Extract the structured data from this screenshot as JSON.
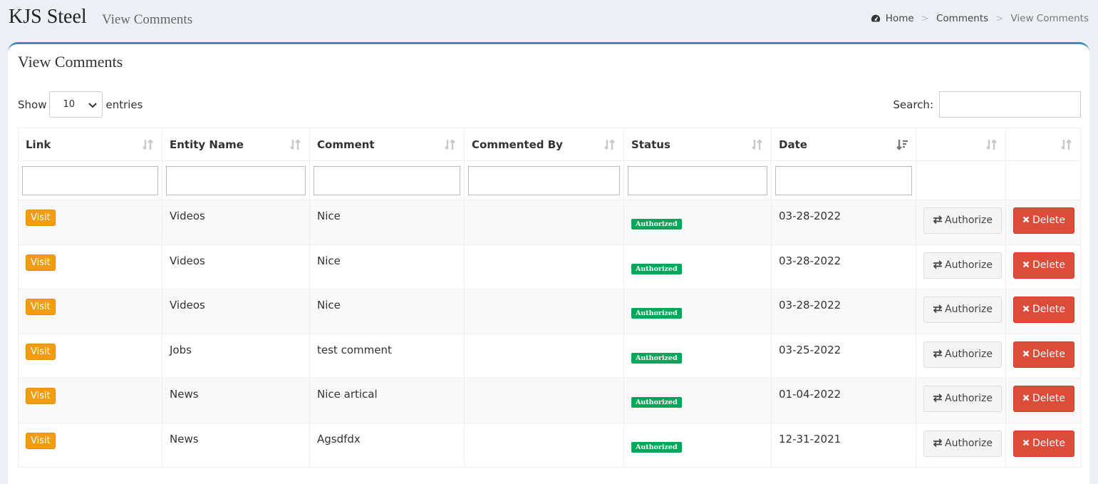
{
  "header": {
    "brand": "KJS Steel",
    "subtitle": "View Comments"
  },
  "breadcrumb": {
    "home": "Home",
    "section": "Comments",
    "current": "View Comments",
    "separator": ">"
  },
  "box": {
    "title": "View Comments"
  },
  "length": {
    "show_label": "Show",
    "value": "10",
    "entries_label": "entries"
  },
  "search": {
    "label": "Search:",
    "value": ""
  },
  "table": {
    "columns": [
      "Link",
      "Entity Name",
      "Comment",
      "Commented By",
      "Status",
      "Date",
      "",
      ""
    ],
    "rows": [
      {
        "link": "Visit",
        "entity": "Videos",
        "comment": "Nice",
        "by": "",
        "status": "Authorized",
        "date": "03-28-2022",
        "authorize": "Authorize",
        "delete": "Delete"
      },
      {
        "link": "Visit",
        "entity": "Videos",
        "comment": "Nice",
        "by": "",
        "status": "Authorized",
        "date": "03-28-2022",
        "authorize": "Authorize",
        "delete": "Delete"
      },
      {
        "link": "Visit",
        "entity": "Videos",
        "comment": "Nice",
        "by": "",
        "status": "Authorized",
        "date": "03-28-2022",
        "authorize": "Authorize",
        "delete": "Delete"
      },
      {
        "link": "Visit",
        "entity": "Jobs",
        "comment": "test comment",
        "by": "",
        "status": "Authorized",
        "date": "03-25-2022",
        "authorize": "Authorize",
        "delete": "Delete"
      },
      {
        "link": "Visit",
        "entity": "News",
        "comment": "Nice artical",
        "by": "",
        "status": "Authorized",
        "date": "01-04-2022",
        "authorize": "Authorize",
        "delete": "Delete"
      },
      {
        "link": "Visit",
        "entity": "News",
        "comment": "Agsdfdx",
        "by": "",
        "status": "Authorized",
        "date": "12-31-2021",
        "authorize": "Authorize",
        "delete": "Delete"
      }
    ]
  },
  "icons": {
    "home": "dashboard-icon",
    "authorize": "exchange-icon",
    "delete": "times-icon",
    "sort": "sort-icon",
    "sort_active": "sort-amount-desc-icon"
  },
  "colors": {
    "accent": "#3c8dbc",
    "visit": "#f39c12",
    "authorized": "#00a65a",
    "delete": "#dd4b39"
  }
}
